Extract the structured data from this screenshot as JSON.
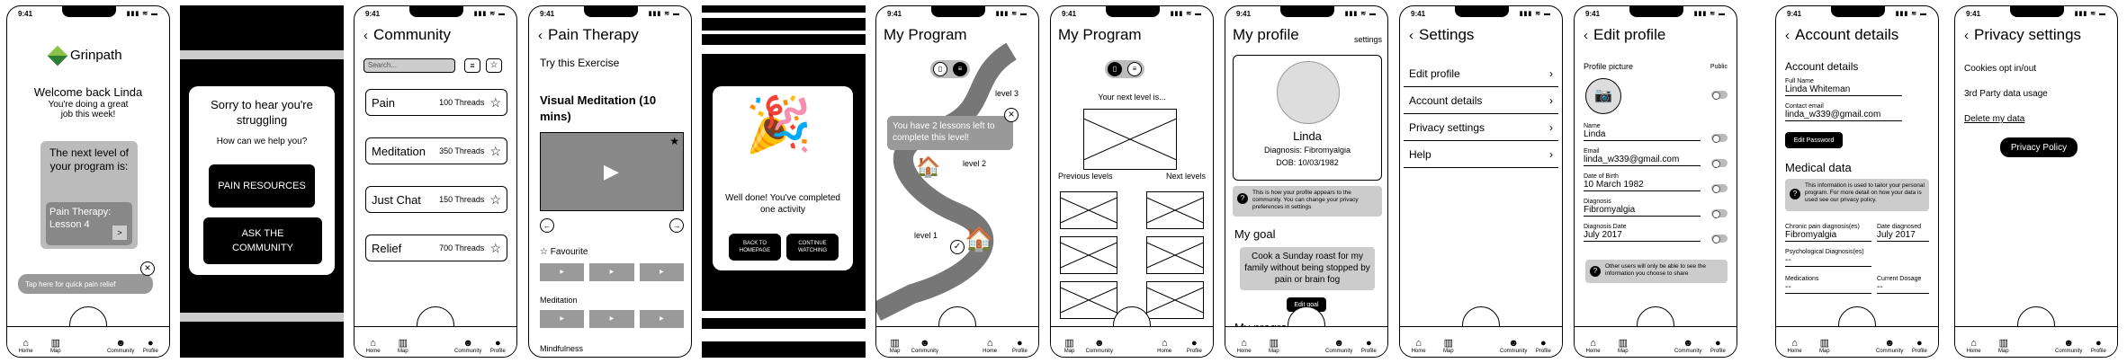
{
  "status_time": "9:41",
  "status_icons": "▮▮▮ ≋ ▬",
  "tabs": {
    "home": "Home",
    "map": "Map",
    "community": "Community",
    "profile": "Profile"
  },
  "s1": {
    "brand": "Grinpath",
    "welcome": "Welcome back Linda",
    "subtitle": "You're doing a great job this week!",
    "next_level": "The next level of your program is:",
    "lesson": "Pain Therapy: Lesson 4",
    "quick_relief": "Tap here for quick pain relief"
  },
  "s2": {
    "sorry": "Sorry to hear you're struggling",
    "help": "How can we help you?",
    "btn_resources": "PAIN RESOURCES",
    "btn_community": "ASK THE COMMUNITY"
  },
  "s3": {
    "title": "Community",
    "search_placeholder": "Search...",
    "topics": [
      {
        "name": "Pain",
        "threads": "100 Threads"
      },
      {
        "name": "Meditation",
        "threads": "350 Threads"
      },
      {
        "name": "Just Chat",
        "threads": "150 Threads"
      },
      {
        "name": "Relief",
        "threads": "700 Threads"
      }
    ]
  },
  "s4": {
    "title": "Pain Therapy",
    "try": "Try this Exercise",
    "exercise": "Visual Meditation (10 mins)",
    "favourite": "Favourite",
    "meditation": "Meditation",
    "mindfulness": "Mindfulness"
  },
  "s5": {
    "well_done": "Well done! You've completed one activity",
    "btn_home": "BACK TO HOMEPAGE",
    "btn_continue": "CONTINUE WATCHING"
  },
  "s6": {
    "title": "My Program",
    "tooltip": "You have 2 lessons left to complete this level!",
    "level1": "level 1",
    "level2": "level 2",
    "level3": "level 3"
  },
  "s7": {
    "title": "My Program",
    "next_level": "Your next level is...",
    "previous": "Previous levels",
    "next": "Next levels"
  },
  "s8": {
    "title": "My profile",
    "settings": "settings",
    "name": "Linda",
    "diagnosis": "Diagnosis: Fibromyalgia",
    "dob": "DOB: 10/03/1982",
    "info": "This is how your profile appears to the community. You can change your privacy preferences in settings",
    "goal_heading": "My goal",
    "goal": "Cook a Sunday roast for my family without being stopped by pain or brain fog",
    "edit_goal": "Edit goal",
    "program_heading": "My program"
  },
  "s9": {
    "title": "Settings",
    "items": [
      "Edit profile",
      "Account details",
      "Privacy settings",
      "Help"
    ]
  },
  "s10": {
    "title": "Edit profile",
    "profile_picture": "Profile picture",
    "public": "Public",
    "fields": [
      {
        "label": "Name",
        "value": "Linda"
      },
      {
        "label": "Email",
        "value": "linda_w339@gmail.com"
      },
      {
        "label": "Date of Birth",
        "value": "10 March 1982"
      },
      {
        "label": "Diagnosis",
        "value": "Fibromyalgia"
      },
      {
        "label": "Diagnosis Date",
        "value": "July 2017"
      }
    ],
    "info": "Other users will only be able to see the information you choose to share"
  },
  "s11": {
    "title": "Account details",
    "section": "Account details",
    "full_name_label": "Full Name",
    "full_name": "Linda Whiteman",
    "contact_label": "Contact email",
    "contact": "linda_w339@gmail.com",
    "edit_password": "Edit Password",
    "medical": "Medical data",
    "info": "This information is used to tailor your personal program. For more detail on how your data is used see our privacy policy.",
    "chronic_label": "Chronic pain diagnosis(es)",
    "chronic": "Fibromyalgia",
    "date_label": "Date diagnosed",
    "date": "July 2017",
    "psych_label": "Psychological Diagnosis(es)",
    "psych": "--",
    "meds_label": "Medications",
    "meds": "--",
    "dosage_label": "Current Dosage",
    "dosage": "--"
  },
  "s12": {
    "title": "Privacy settings",
    "cookies": "Cookies opt in/out",
    "third_party": "3rd Party data usage",
    "delete": "Delete my data",
    "policy": "Privacy Policy"
  }
}
